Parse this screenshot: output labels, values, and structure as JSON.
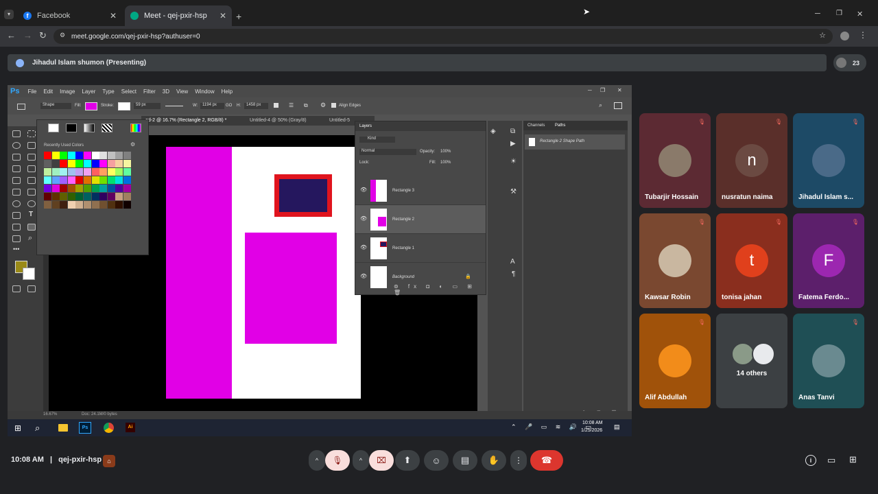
{
  "browser": {
    "tabs": [
      {
        "title": "Facebook",
        "active": false
      },
      {
        "title": "Meet - qej-pxir-hsp",
        "active": true
      }
    ],
    "new_tab_icon": "plus-icon",
    "address": "meet.google.com/qej-pxir-hsp?authuser=0",
    "window_controls": [
      "minimize-icon",
      "restore-icon",
      "close-icon"
    ]
  },
  "meet": {
    "presenting_label": "Jihadul Islam shumon (Presenting)",
    "participant_count": "23",
    "tiles": [
      {
        "name": "Tubarjir Hossain",
        "initial": "",
        "muted": true,
        "bg": "#5c2a33",
        "avatar_bg": "#8a7a6a"
      },
      {
        "name": "nusratun naima",
        "initial": "n",
        "muted": true,
        "bg": "#5a2f2a",
        "avatar_bg": "#6b4a42"
      },
      {
        "name": "Jihadul Islam s...",
        "initial": "",
        "muted": true,
        "bg": "#1d4a66",
        "avatar_bg": "#4a6a88"
      },
      {
        "name": "Kawsar Robin",
        "initial": "",
        "muted": true,
        "bg": "#7a4830",
        "avatar_bg": "#c9b7a0"
      },
      {
        "name": "tonisa jahan",
        "initial": "t",
        "muted": true,
        "bg": "#8a2e1e",
        "avatar_bg": "#e0401c"
      },
      {
        "name": "Fatema Ferdo...",
        "initial": "F",
        "muted": true,
        "bg": "#5c1f6b",
        "avatar_bg": "#9c27b0"
      },
      {
        "name": "Alif Abdullah",
        "initial": "",
        "muted": true,
        "bg": "#a0520a",
        "avatar_bg": "#f28c1a"
      },
      {
        "name": "14 others",
        "initial": "",
        "muted": false,
        "bg": "#3c4043",
        "avatar_bg": "#5f6368"
      },
      {
        "name": "Anas Tanvi",
        "initial": "",
        "muted": true,
        "bg": "#1f4f55",
        "avatar_bg": "#6a8a90"
      }
    ],
    "bottom": {
      "time": "10:08 AM",
      "separator": "|",
      "meeting_code": "qej-pxir-hsp",
      "icons": [
        "mic-off-icon",
        "camera-off-icon",
        "present-icon",
        "emoji-icon",
        "captions-icon",
        "raise-hand-icon",
        "more-icon",
        "hang-up-icon"
      ],
      "right_icons": [
        "info-icon",
        "chat-icon",
        "activities-icon"
      ]
    }
  },
  "photoshop": {
    "logo": "Ps",
    "menu": [
      "File",
      "Edit",
      "Image",
      "Layer",
      "Type",
      "Select",
      "Filter",
      "3D",
      "View",
      "Window",
      "Help"
    ],
    "options": {
      "shape_mode": "Shape",
      "fill_label": "Fill:",
      "stroke_label": "Stroke:",
      "stroke_size": "59 px",
      "w_label": "W:",
      "w_value": "1194 px",
      "link": "GO",
      "h_label": "H:",
      "h_value": "1458 px",
      "align_edges": "Align Edges"
    },
    "doc_tabs": [
      "ed-2 @ 16.7% (Rectangle 2, RGB/8) *",
      "Untitled-4 @ 50% (Gray/8)",
      "Untitled-5"
    ],
    "swatch_panel_title": "Recently Used Colors",
    "layers_panel": {
      "tab": "Layers",
      "kind": "Kind",
      "blend": "Normal",
      "opacity_label": "Opacity:",
      "opacity": "100%",
      "lock_label": "Lock:",
      "fill_label": "Fill:",
      "fill": "100%",
      "layers": [
        "Rectangle 3",
        "Rectangle 2",
        "Rectangle 1",
        "Background"
      ]
    },
    "paths_panel": {
      "tabs": [
        "Channels",
        "Paths"
      ],
      "item": "Rectangle 2 Shape Path"
    },
    "status": {
      "zoom": "16.67%",
      "doc": "Doc: 24.1M/0 bytes"
    },
    "taskbar": {
      "time": "10:08 AM",
      "date": "1/25/2026"
    },
    "colors": {
      "magenta": "#e100e6",
      "navy": "#25175e",
      "red": "#e0141e"
    }
  }
}
